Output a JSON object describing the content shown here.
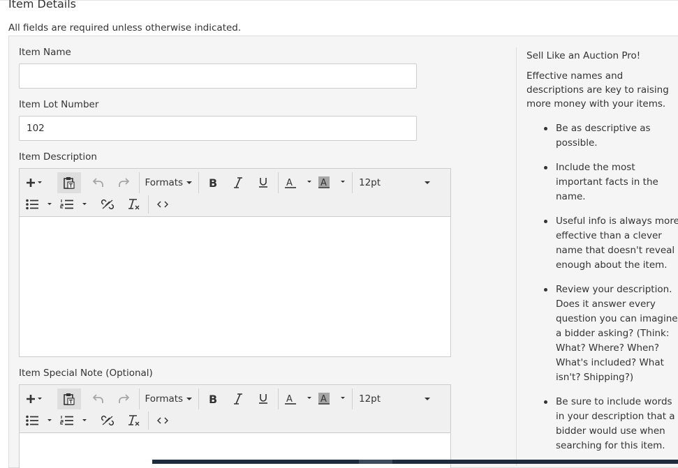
{
  "page": {
    "heading": "Item Details",
    "required_note": "All fields are required unless otherwise indicated."
  },
  "form": {
    "item_name": {
      "label": "Item Name",
      "value": "",
      "placeholder": ""
    },
    "item_lot_number": {
      "label": "Item Lot Number",
      "value": "102"
    },
    "item_description": {
      "label": "Item Description",
      "content": ""
    },
    "item_special_note": {
      "label": "Item Special Note (Optional)",
      "content": ""
    }
  },
  "toolbar": {
    "formats_label": "Formats",
    "font_size": "12pt",
    "icons": [
      "insert-plus-icon",
      "paste-as-text-icon",
      "undo-icon",
      "redo-icon",
      "bold-icon",
      "italic-icon",
      "underline-icon",
      "text-color-icon",
      "background-color-icon",
      "bullet-list-icon",
      "numbered-list-icon",
      "unlink-icon",
      "clear-formatting-icon",
      "source-code-icon"
    ]
  },
  "sidebar": {
    "title": "Sell Like an Auction Pro!",
    "intro": "Effective names and descriptions are key to raising more money with your items.",
    "tips": [
      "Be as descriptive as possible.",
      "Include the most important facts in the name.",
      "Useful info is always more effective than a clever name that doesn't reveal enough about the item.",
      "Review your description. Does it answer every question you can imagine a bidder asking? (Think: What? Where? When? What's included? What isn't? Shipping?)",
      "Be sure to include words in your description that a bidder would use when searching for this item."
    ]
  },
  "colors": {
    "panel_background": "#f5f5f5",
    "toolbar_background": "#f0f0f0",
    "active_button": "#dedede",
    "disabled_icon": "#a6a6a6",
    "bottom_bar": "#1e2b3c"
  }
}
